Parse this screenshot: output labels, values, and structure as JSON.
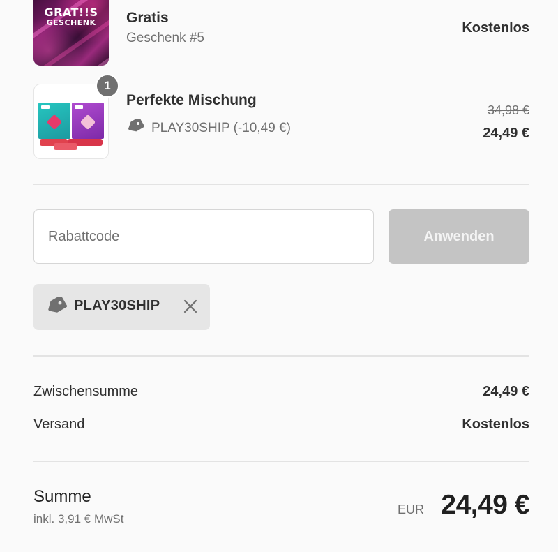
{
  "items": [
    {
      "title": "Gratis",
      "subtitle": "Geschenk #5",
      "price": "Kostenlos",
      "image_text_line1": "GRAT!!S",
      "image_text_line2": "GESCHENK"
    },
    {
      "quantity": "1",
      "title": "Perfekte Mischung",
      "discount_line": "PLAY30SHIP (-10,49 €)",
      "original_price": "34,98 €",
      "price": "24,49 €"
    }
  ],
  "discount_form": {
    "placeholder": "Rabattcode",
    "apply_label": "Anwenden"
  },
  "applied_code": {
    "label": "PLAY30SHIP"
  },
  "summary": {
    "subtotal_label": "Zwischensumme",
    "subtotal_value": "24,49 €",
    "shipping_label": "Versand",
    "shipping_value": "Kostenlos"
  },
  "total": {
    "label": "Summe",
    "tax_note": "inkl. 3,91 € MwSt",
    "currency": "EUR",
    "value": "24,49 €"
  },
  "icons": {
    "tag": "tag-icon",
    "remove": "close-icon"
  },
  "colors": {
    "badge": "#707070",
    "button_disabled": "#c4c4c4",
    "chip_background": "#e6e6e6",
    "divider": "#e3e3e3"
  }
}
